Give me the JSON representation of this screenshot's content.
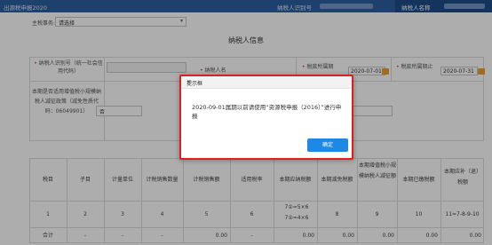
{
  "topbar": {
    "title": "出源税申报2020",
    "tab1": "纳税人识别号",
    "tab2": "纳税人名称"
  },
  "main_tax_item": {
    "label": "主税事务:",
    "value": "请选择"
  },
  "section_title": "纳税人信息",
  "fields": {
    "taxpayer_id_label": "纳税人识别号（统一社会信用代码）",
    "taxpayer_name_label": "纳税人名",
    "period_start_label": "税款所属期",
    "period_start_value": "2020-07-01",
    "period_end_label": "税款所属期止",
    "period_end_value": "2020-07-31",
    "small_scale_label": "本期是否适用增值税小规模纳税人减征政策（减免性质代码：06049901）",
    "small_scale_value": "否",
    "right_select_value": "非"
  },
  "table": {
    "headers": [
      "税目",
      "子目",
      "计量单位",
      "计税销售数量",
      "计税销售额",
      "适用税率",
      "本期应纳税额",
      "本期减免税额",
      "本期增值税小规模纳税人减征额",
      "本期已缴税额",
      "本期应补（退）税额"
    ],
    "index_row": [
      "1",
      "2",
      "3",
      "4",
      "5",
      "6",
      "7①=5×6 7②=4×6",
      "8",
      "9",
      "10",
      "11=7-8-9-10"
    ],
    "total_label": "合计",
    "total_values": [
      "-",
      "-",
      "-",
      "0.00",
      "-",
      "0.00",
      "0.00",
      "0.00",
      "0.00",
      "0.00"
    ]
  },
  "dialog": {
    "title": "提示框",
    "close": "×",
    "message": "2020-09-01属期以前请使用“资源税申报（2016）”进行申报",
    "ok_label": "确定"
  },
  "colors": {
    "topbar": "#2c5fa0",
    "primary_button": "#1e88e5",
    "highlight_border": "#e02020",
    "calendar_icon": "#f0a02c"
  },
  "icons": [
    "calendar-icon",
    "close-icon",
    "chevron-down-icon"
  ]
}
